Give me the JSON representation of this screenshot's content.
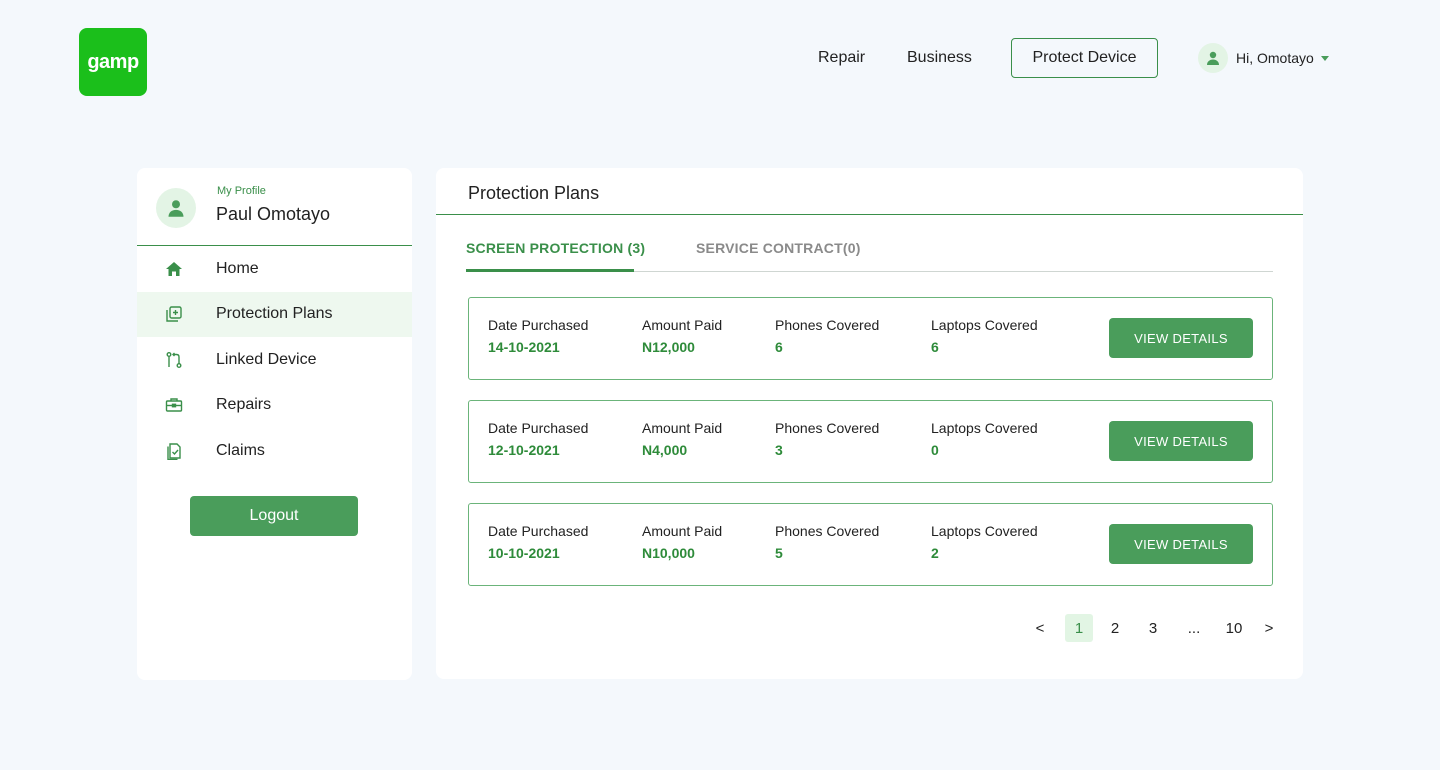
{
  "header": {
    "logo_text": "gamp",
    "nav": {
      "repair": "Repair",
      "business": "Business",
      "protect": "Protect Device"
    },
    "user_greeting": "Hi, Omotayo"
  },
  "sidebar": {
    "profile_label": "My Profile",
    "profile_name": "Paul Omotayo",
    "items": [
      {
        "label": "Home",
        "icon": "home-icon"
      },
      {
        "label": "Protection Plans",
        "icon": "add-plan-icon"
      },
      {
        "label": "Linked Device",
        "icon": "link-icon"
      },
      {
        "label": "Repairs",
        "icon": "toolbox-icon"
      },
      {
        "label": "Claims",
        "icon": "claims-icon"
      }
    ],
    "active_item": "Protection Plans",
    "logout_label": "Logout"
  },
  "main": {
    "title": "Protection Plans",
    "tabs": [
      {
        "label": "SCREEN PROTECTION (3)"
      },
      {
        "label": "SERVICE CONTRACT(0)"
      }
    ],
    "field_labels": {
      "date": "Date Purchased",
      "amount": "Amount Paid",
      "phones": "Phones Covered",
      "laptops": "Laptops Covered"
    },
    "view_details_label": "VIEW DETAILS",
    "plans": [
      {
        "date": "14-10-2021",
        "amount": "N12,000",
        "phones": "6",
        "laptops": "6"
      },
      {
        "date": "12-10-2021",
        "amount": "N4,000",
        "phones": "3",
        "laptops": "0"
      },
      {
        "date": "10-10-2021",
        "amount": "N10,000",
        "phones": "5",
        "laptops": "2"
      }
    ],
    "pagination": {
      "prev": "<",
      "pages": [
        "1",
        "2",
        "3",
        "...",
        "10"
      ],
      "current": "1",
      "next": ">"
    }
  },
  "colors": {
    "brand_logo": "#1bbf1b",
    "accent": "#4a9d5b",
    "value_text": "#2e8b3a",
    "page_bg": "#f4f8fc"
  }
}
